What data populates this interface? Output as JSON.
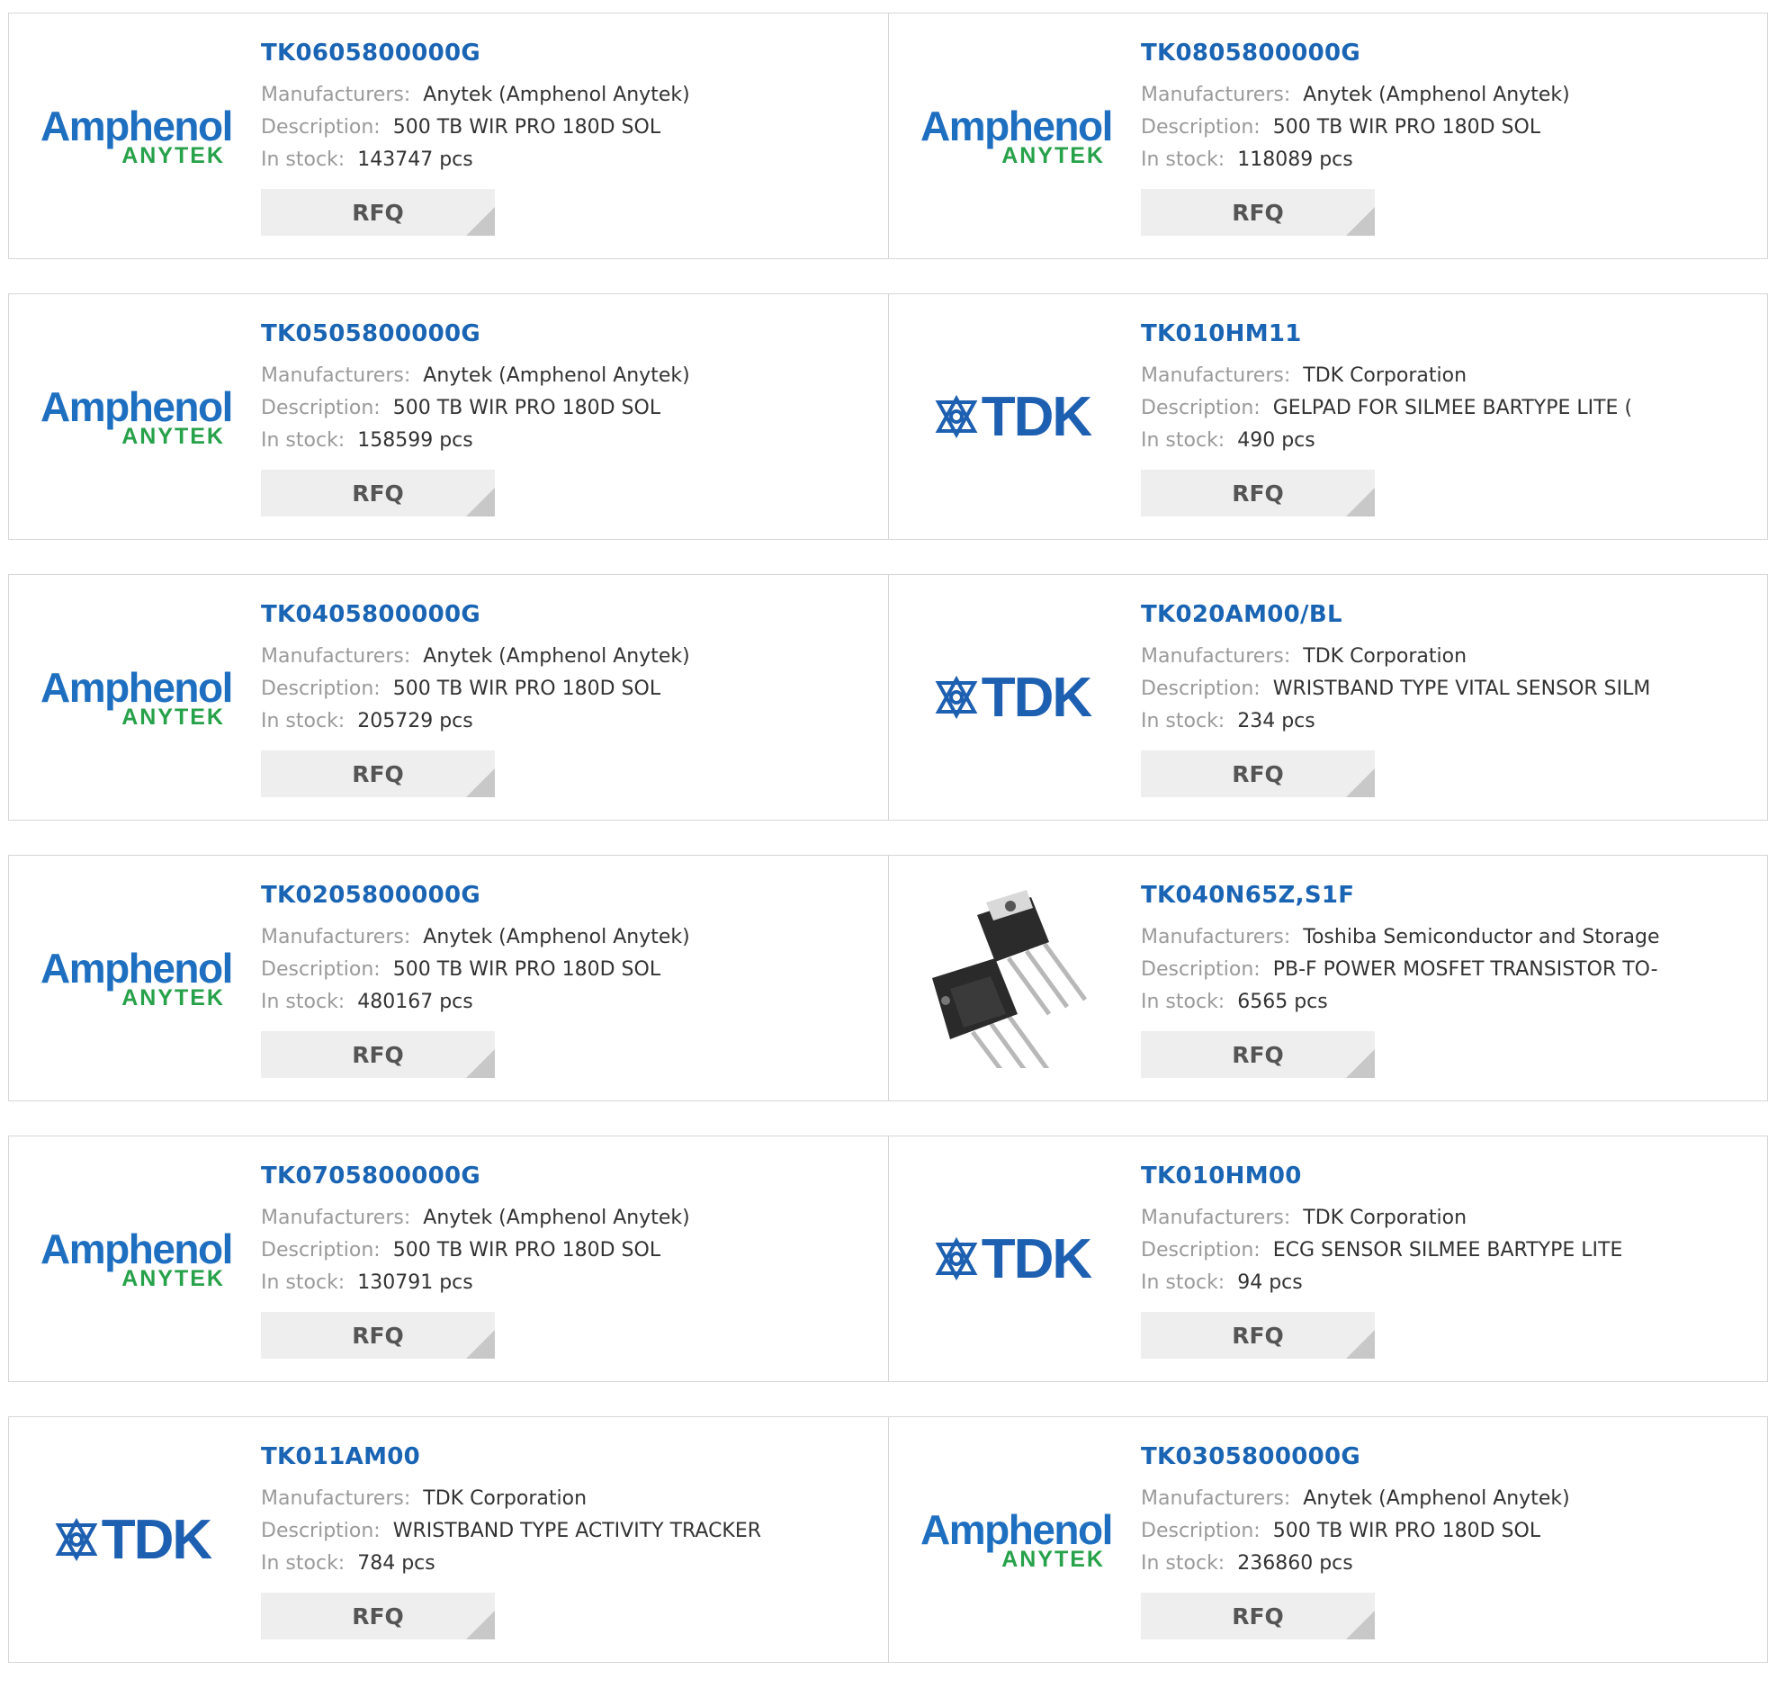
{
  "labels": {
    "manufacturers": "Manufacturers:",
    "description": "Description:",
    "in_stock": "In stock:",
    "rfq": "RFQ"
  },
  "logos": {
    "amphenol_top": "Amphenol",
    "amphenol_bottom": "ANYTEK",
    "tdk": "TDK"
  },
  "colors": {
    "part_link": "#1a64b4",
    "label": "#9a9a9a",
    "value": "#333333",
    "rfq_bg": "#eeeeee"
  },
  "products": [
    {
      "part": "TK0605800000G",
      "manufacturer": "Anytek (Amphenol Anytek)",
      "description": "500 TB WIR PRO 180D SOL",
      "stock": "143747 pcs",
      "logo": "amphenol"
    },
    {
      "part": "TK0805800000G",
      "manufacturer": "Anytek (Amphenol Anytek)",
      "description": "500 TB WIR PRO 180D SOL",
      "stock": "118089 pcs",
      "logo": "amphenol"
    },
    {
      "part": "TK0505800000G",
      "manufacturer": "Anytek (Amphenol Anytek)",
      "description": "500 TB WIR PRO 180D SOL",
      "stock": "158599 pcs",
      "logo": "amphenol"
    },
    {
      "part": "TK010HM11",
      "manufacturer": "TDK Corporation",
      "description": "GELPAD FOR SILMEE BARTYPE LITE (",
      "stock": "490 pcs",
      "logo": "tdk"
    },
    {
      "part": "TK0405800000G",
      "manufacturer": "Anytek (Amphenol Anytek)",
      "description": "500 TB WIR PRO 180D SOL",
      "stock": "205729 pcs",
      "logo": "amphenol"
    },
    {
      "part": "TK020AM00/BL",
      "manufacturer": "TDK Corporation",
      "description": "WRISTBAND TYPE VITAL SENSOR SILM",
      "stock": "234 pcs",
      "logo": "tdk"
    },
    {
      "part": "TK0205800000G",
      "manufacturer": "Anytek (Amphenol Anytek)",
      "description": "500 TB WIR PRO 180D SOL",
      "stock": "480167 pcs",
      "logo": "amphenol"
    },
    {
      "part": "TK040N65Z,S1F",
      "manufacturer": "Toshiba Semiconductor and Storage",
      "description": "PB-F POWER MOSFET TRANSISTOR TO-",
      "stock": "6565 pcs",
      "logo": "transistor"
    },
    {
      "part": "TK0705800000G",
      "manufacturer": "Anytek (Amphenol Anytek)",
      "description": "500 TB WIR PRO 180D SOL",
      "stock": "130791 pcs",
      "logo": "amphenol"
    },
    {
      "part": "TK010HM00",
      "manufacturer": "TDK Corporation",
      "description": "ECG SENSOR SILMEE BARTYPE LITE",
      "stock": "94 pcs",
      "logo": "tdk"
    },
    {
      "part": "TK011AM00",
      "manufacturer": "TDK Corporation",
      "description": "WRISTBAND TYPE ACTIVITY TRACKER",
      "stock": "784 pcs",
      "logo": "tdk"
    },
    {
      "part": "TK0305800000G",
      "manufacturer": "Anytek (Amphenol Anytek)",
      "description": "500 TB WIR PRO 180D SOL",
      "stock": "236860 pcs",
      "logo": "amphenol"
    }
  ]
}
